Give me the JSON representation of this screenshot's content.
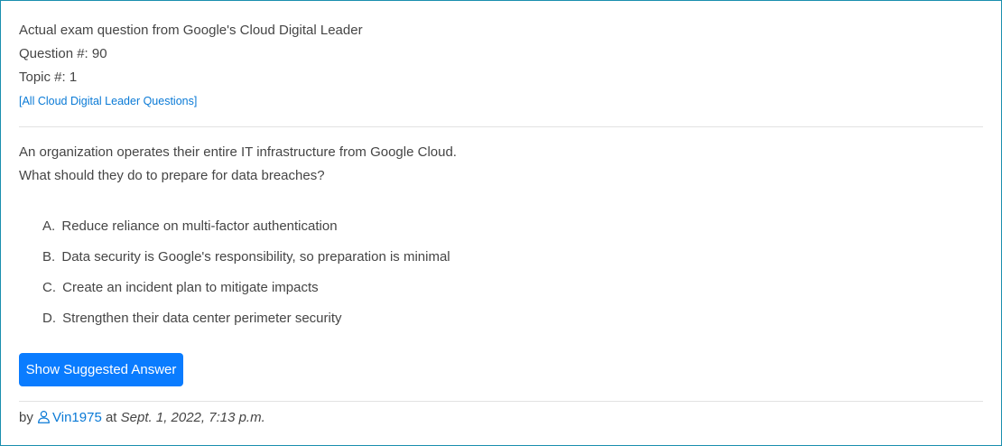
{
  "header": {
    "exam_line": "Actual exam question from Google's Cloud Digital Leader",
    "question_number": "Question #: 90",
    "topic_number": "Topic #: 1",
    "all_questions_link": "[All Cloud Digital Leader Questions]"
  },
  "question": {
    "line1": "An organization operates their entire IT infrastructure from Google Cloud.",
    "line2": "What should they do to prepare for data breaches?"
  },
  "choices": [
    {
      "letter": "A.",
      "text": "Reduce reliance on multi-factor authentication"
    },
    {
      "letter": "B.",
      "text": "Data security is Google's responsibility, so preparation is minimal"
    },
    {
      "letter": "C.",
      "text": "Create an incident plan to mitigate impacts"
    },
    {
      "letter": "D.",
      "text": "Strengthen their data center perimeter security"
    }
  ],
  "buttons": {
    "show_answer_label": "Show Suggested Answer"
  },
  "footer": {
    "by_label": "by",
    "username": "Vin1975",
    "at_label": "at",
    "date": "Sept. 1, 2022, 7:13 p.m."
  },
  "icons": {
    "user": "user-outline-icon"
  },
  "colors": {
    "link": "#0a7ad6",
    "button_bg": "#0a7cff",
    "card_border": "#1a8fae",
    "text": "#454545"
  }
}
